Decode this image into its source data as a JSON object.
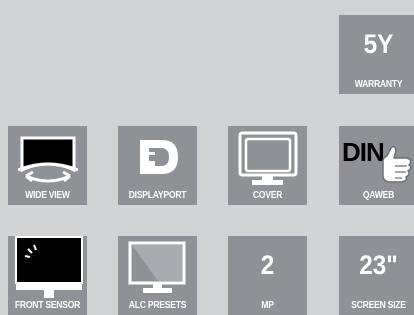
{
  "colors": {
    "background": "#d1d3d4",
    "tile": "#8e9195",
    "foreground": "#ffffff",
    "screen": "#000000"
  },
  "tiles": {
    "warranty": {
      "value": "5Y",
      "label": "WARRANTY"
    },
    "wide_view": {
      "label": "WIDE VIEW",
      "icon": "wide-view-icon"
    },
    "displayport": {
      "label": "DISPLAYPORT",
      "icon": "displayport-icon"
    },
    "cover": {
      "label": "COVER",
      "icon": "monitor-cover-icon"
    },
    "qaweb": {
      "label": "QAWEB",
      "icon_text": "DIN",
      "icon": "thumbs-up-icon"
    },
    "front_sensor": {
      "label": "FRONT SENSOR",
      "icon": "front-sensor-icon"
    },
    "alc_presets": {
      "label": "ALC PRESETS",
      "icon": "alc-monitor-icon"
    },
    "mp": {
      "value": "2",
      "label": "MP"
    },
    "screen_size": {
      "value": "23\"",
      "label": "SCREEN SIZE"
    }
  }
}
